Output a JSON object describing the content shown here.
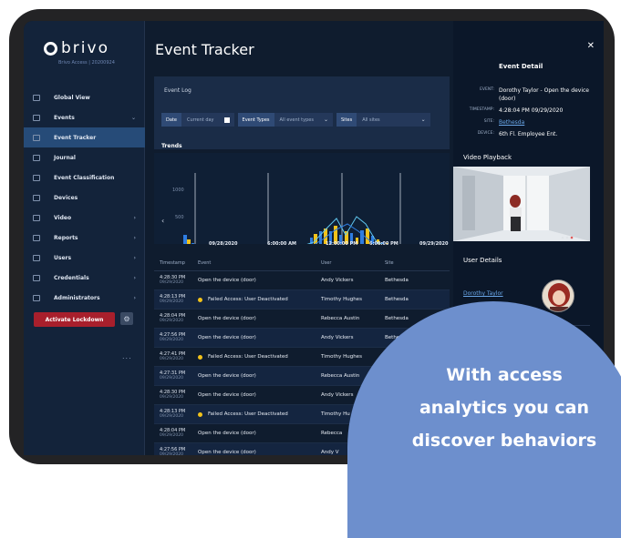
{
  "brand": {
    "name": "brivo",
    "subtitle": "Brivo Access | 20200924"
  },
  "sidebar": {
    "items": [
      {
        "label": "Global View",
        "icon": "globe-icon"
      },
      {
        "label": "Events",
        "icon": "events-icon"
      },
      {
        "label": "Event Tracker",
        "icon": "tracker-icon"
      },
      {
        "label": "Journal",
        "icon": "journal-icon"
      },
      {
        "label": "Event Classification",
        "icon": "classification-icon"
      },
      {
        "label": "Devices",
        "icon": "devices-icon"
      },
      {
        "label": "Video",
        "icon": "video-icon"
      },
      {
        "label": "Reports",
        "icon": "reports-icon"
      },
      {
        "label": "Users",
        "icon": "users-icon"
      },
      {
        "label": "Credentials",
        "icon": "credentials-icon"
      },
      {
        "label": "Administrators",
        "icon": "admin-icon"
      }
    ],
    "lockdown_label": "Activate Lockdown",
    "more_label": "..."
  },
  "main": {
    "title": "Event Tracker",
    "panel_title": "Event Log",
    "filters": {
      "date_label": "Date",
      "date_value": "Current day",
      "types_label": "Event Types",
      "types_value": "All event types",
      "sites_label": "Sites",
      "sites_value": "All sites"
    },
    "trends_label": "Trends"
  },
  "chart_data": {
    "type": "bar",
    "yticks": [
      "1000",
      "500",
      "0"
    ],
    "xticks": [
      "09/28/2020",
      "6:00:00 AM",
      "12:00:00 PM",
      "6:00:00 PM",
      "09/29/2020"
    ],
    "colors": {
      "series_a": "#f2c21a",
      "series_b": "#2f7de1",
      "line": "#5fc6ef"
    }
  },
  "table": {
    "headers": [
      "Timestamp",
      "Event",
      "User",
      "Site"
    ],
    "rows": [
      {
        "time": "4:28:30 PM",
        "date": "09/29/2020",
        "event": "Open the device (door)",
        "warn": false,
        "user": "Andy Vickers",
        "site": "Bethesda"
      },
      {
        "time": "4:28:13 PM",
        "date": "09/29/2020",
        "event": "Failed Access: User Deactivated",
        "warn": true,
        "user": "Timothy Hughes",
        "site": "Bethesda"
      },
      {
        "time": "4:28:04 PM",
        "date": "09/29/2020",
        "event": "Open the device (door)",
        "warn": false,
        "user": "Rebecca Austin",
        "site": "Bethesda"
      },
      {
        "time": "4:27:56 PM",
        "date": "09/29/2020",
        "event": "Open the device (door)",
        "warn": false,
        "user": "Andy Vickers",
        "site": "Bethesda"
      },
      {
        "time": "4:27:41 PM",
        "date": "09/29/2020",
        "event": "Failed Access: User Deactivated",
        "warn": true,
        "user": "Timothy Hughes",
        "site": "Be"
      },
      {
        "time": "4:27:31 PM",
        "date": "09/29/2020",
        "event": "Open the device (door)",
        "warn": false,
        "user": "Rebecca Austin",
        "site": ""
      },
      {
        "time": "4:28:30 PM",
        "date": "09/29/2020",
        "event": "Open the device (door)",
        "warn": false,
        "user": "Andy Vickers",
        "site": ""
      },
      {
        "time": "4:28:13 PM",
        "date": "09/29/2020",
        "event": "Failed Access: User Deactivated",
        "warn": true,
        "user": "Timothy Hu",
        "site": ""
      },
      {
        "time": "4:28:04 PM",
        "date": "09/29/2020",
        "event": "Open the device (door)",
        "warn": false,
        "user": "Rebecca",
        "site": ""
      },
      {
        "time": "4:27:56 PM",
        "date": "09/29/2020",
        "event": "Open the device (door)",
        "warn": false,
        "user": "Andy V",
        "site": ""
      }
    ]
  },
  "detail": {
    "title": "Event Detail",
    "event_label": "EVENT:",
    "event_value": "Dorothy Taylor - Open the device (door)",
    "timestamp_label": "TIMESTAMP:",
    "timestamp_value": "4:28:04 PM 09/29/2020",
    "site_label": "SITE:",
    "site_value": "Bethesda",
    "device_label": "DEVICE:",
    "device_value": "6th Fl. Employee Ent.",
    "video_title": "Video Playback",
    "user_title": "User Details",
    "user_name": "Dorothy Taylor"
  },
  "promo": {
    "line1": "With access",
    "line2": "analytics you can",
    "line3": "discover behaviors"
  }
}
